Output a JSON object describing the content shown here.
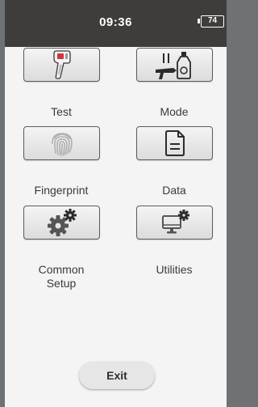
{
  "status_bar": {
    "time": "09:36",
    "battery_level": "74"
  },
  "menu": [
    {
      "label": "Test",
      "icon": "handheld-analyzer-icon"
    },
    {
      "label": "Mode",
      "icon": "mode-icon"
    },
    {
      "label": "Fingerprint",
      "icon": "fingerprint-icon"
    },
    {
      "label": "Data",
      "icon": "document-icon"
    },
    {
      "label": "Common\nSetup",
      "icon": "gear-icon"
    },
    {
      "label": "Utilities",
      "icon": "monitor-gear-icon"
    }
  ],
  "exit_label": "Exit",
  "colors": {
    "status_bar": "#3f3d3c",
    "background": "#f4f4f4",
    "icon_dark": "#2b2b2b",
    "accent_red": "#d0363f"
  }
}
